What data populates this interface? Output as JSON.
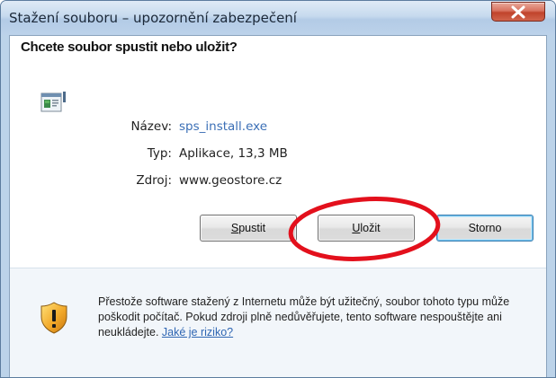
{
  "window": {
    "title": "Stažení souboru – upozornění zabezpečení"
  },
  "dialog": {
    "question": "Chcete soubor spustit nebo uložit?",
    "fields": [
      {
        "label": "Název:",
        "value": "sps_install.exe"
      },
      {
        "label": "Typ:",
        "value": "Aplikace, 13,3 MB"
      },
      {
        "label": "Zdroj:",
        "value": "www.geostore.cz"
      }
    ],
    "buttons": {
      "run_prefix": "S",
      "run_rest": "pustit",
      "save_prefix": "U",
      "save_rest": "ložit",
      "cancel": "Storno"
    },
    "warning": {
      "text": "Přestože software stažený z Internetu může být užitečný, soubor tohoto typu může poškodit počítač. Pokud zdroji plně nedůvěřujete, tento software nespouštějte ani neukládejte.",
      "link": "Jaké je riziko?"
    }
  },
  "colors": {
    "link": "#3b6fb6",
    "highlight_ring": "#e3101c",
    "titlebar": "#c6daee"
  }
}
